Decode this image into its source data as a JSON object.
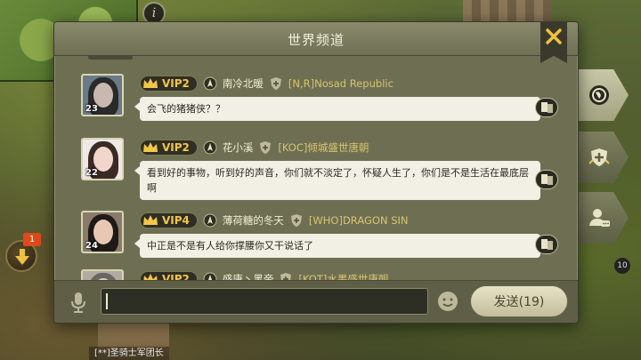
{
  "window": {
    "title": "世界频道"
  },
  "messages": [
    {
      "avatar_number": "23",
      "vip_label": "VIP2",
      "username": "南冷北暖",
      "alliance": "[N,R]Nosad Republic",
      "text": "会飞的猪猪侠？？",
      "avatar_colors": {
        "bg": "#6a7a86",
        "hair": "#2a2a2a",
        "face": "#c8b8b0"
      }
    },
    {
      "avatar_number": "22",
      "vip_label": "VIP2",
      "username": "花小溪",
      "alliance": "[KOC]倾城盛世唐朝",
      "text": "看到好的事物，听到好的声音，你们就不淡定了，怀疑人生了，你们是不是生活在最底层啊",
      "avatar_colors": {
        "bg": "#f0e8e8",
        "hair": "#3a2a26",
        "face": "#f2d6cc"
      }
    },
    {
      "avatar_number": "24",
      "vip_label": "VIP4",
      "username": "薄荷糖的冬天",
      "alliance": "[WHO]DRAGON SIN",
      "text": "中正是不是有人给你撑腰你又干说话了",
      "avatar_colors": {
        "bg": "#8a7a6a",
        "hair": "#1e1a18",
        "face": "#e8c8b4"
      }
    },
    {
      "avatar_number": "",
      "vip_label": "VIP2",
      "username": "盛唐丶黑帝",
      "alliance": "[KOT]水墨盛世唐朝",
      "text": "",
      "avatar_colors": {
        "bg": "#b0aaa0",
        "hair": "#6a6660",
        "face": "#d8d0c8"
      }
    }
  ],
  "input": {
    "value": "",
    "placeholder": ""
  },
  "send_button": {
    "label": "发送(19)"
  },
  "left_badge": {
    "count": "1"
  },
  "side_counter": "10",
  "background_label": "[**]圣骑士军团长",
  "colors": {
    "accent_gold": "#f4c64a",
    "alliance_text": "#d8c470",
    "badge_red": "#e04a1a"
  },
  "icons": {
    "tabs": [
      "globe-icon",
      "alliance-shield-icon",
      "private-chat-icon"
    ],
    "close": "close-icon",
    "mic": "microphone-icon",
    "emoji": "emoji-icon",
    "down": "down-arrow-icon"
  }
}
